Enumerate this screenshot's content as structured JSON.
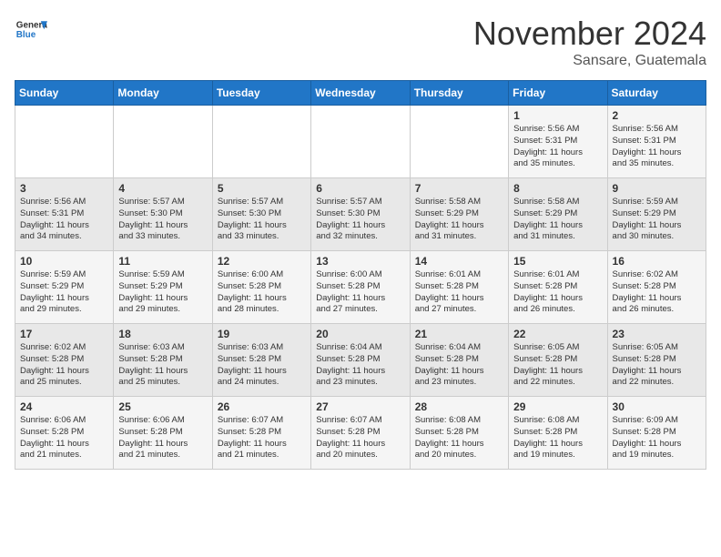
{
  "header": {
    "logo": {
      "general": "General",
      "blue": "Blue"
    },
    "title": "November 2024",
    "location": "Sansare, Guatemala"
  },
  "calendar": {
    "weekdays": [
      "Sunday",
      "Monday",
      "Tuesday",
      "Wednesday",
      "Thursday",
      "Friday",
      "Saturday"
    ],
    "weeks": [
      [
        {
          "day": "",
          "info": ""
        },
        {
          "day": "",
          "info": ""
        },
        {
          "day": "",
          "info": ""
        },
        {
          "day": "",
          "info": ""
        },
        {
          "day": "",
          "info": ""
        },
        {
          "day": "1",
          "info": "Sunrise: 5:56 AM\nSunset: 5:31 PM\nDaylight: 11 hours\nand 35 minutes."
        },
        {
          "day": "2",
          "info": "Sunrise: 5:56 AM\nSunset: 5:31 PM\nDaylight: 11 hours\nand 35 minutes."
        }
      ],
      [
        {
          "day": "3",
          "info": "Sunrise: 5:56 AM\nSunset: 5:31 PM\nDaylight: 11 hours\nand 34 minutes."
        },
        {
          "day": "4",
          "info": "Sunrise: 5:57 AM\nSunset: 5:30 PM\nDaylight: 11 hours\nand 33 minutes."
        },
        {
          "day": "5",
          "info": "Sunrise: 5:57 AM\nSunset: 5:30 PM\nDaylight: 11 hours\nand 33 minutes."
        },
        {
          "day": "6",
          "info": "Sunrise: 5:57 AM\nSunset: 5:30 PM\nDaylight: 11 hours\nand 32 minutes."
        },
        {
          "day": "7",
          "info": "Sunrise: 5:58 AM\nSunset: 5:29 PM\nDaylight: 11 hours\nand 31 minutes."
        },
        {
          "day": "8",
          "info": "Sunrise: 5:58 AM\nSunset: 5:29 PM\nDaylight: 11 hours\nand 31 minutes."
        },
        {
          "day": "9",
          "info": "Sunrise: 5:59 AM\nSunset: 5:29 PM\nDaylight: 11 hours\nand 30 minutes."
        }
      ],
      [
        {
          "day": "10",
          "info": "Sunrise: 5:59 AM\nSunset: 5:29 PM\nDaylight: 11 hours\nand 29 minutes."
        },
        {
          "day": "11",
          "info": "Sunrise: 5:59 AM\nSunset: 5:29 PM\nDaylight: 11 hours\nand 29 minutes."
        },
        {
          "day": "12",
          "info": "Sunrise: 6:00 AM\nSunset: 5:28 PM\nDaylight: 11 hours\nand 28 minutes."
        },
        {
          "day": "13",
          "info": "Sunrise: 6:00 AM\nSunset: 5:28 PM\nDaylight: 11 hours\nand 27 minutes."
        },
        {
          "day": "14",
          "info": "Sunrise: 6:01 AM\nSunset: 5:28 PM\nDaylight: 11 hours\nand 27 minutes."
        },
        {
          "day": "15",
          "info": "Sunrise: 6:01 AM\nSunset: 5:28 PM\nDaylight: 11 hours\nand 26 minutes."
        },
        {
          "day": "16",
          "info": "Sunrise: 6:02 AM\nSunset: 5:28 PM\nDaylight: 11 hours\nand 26 minutes."
        }
      ],
      [
        {
          "day": "17",
          "info": "Sunrise: 6:02 AM\nSunset: 5:28 PM\nDaylight: 11 hours\nand 25 minutes."
        },
        {
          "day": "18",
          "info": "Sunrise: 6:03 AM\nSunset: 5:28 PM\nDaylight: 11 hours\nand 25 minutes."
        },
        {
          "day": "19",
          "info": "Sunrise: 6:03 AM\nSunset: 5:28 PM\nDaylight: 11 hours\nand 24 minutes."
        },
        {
          "day": "20",
          "info": "Sunrise: 6:04 AM\nSunset: 5:28 PM\nDaylight: 11 hours\nand 23 minutes."
        },
        {
          "day": "21",
          "info": "Sunrise: 6:04 AM\nSunset: 5:28 PM\nDaylight: 11 hours\nand 23 minutes."
        },
        {
          "day": "22",
          "info": "Sunrise: 6:05 AM\nSunset: 5:28 PM\nDaylight: 11 hours\nand 22 minutes."
        },
        {
          "day": "23",
          "info": "Sunrise: 6:05 AM\nSunset: 5:28 PM\nDaylight: 11 hours\nand 22 minutes."
        }
      ],
      [
        {
          "day": "24",
          "info": "Sunrise: 6:06 AM\nSunset: 5:28 PM\nDaylight: 11 hours\nand 21 minutes."
        },
        {
          "day": "25",
          "info": "Sunrise: 6:06 AM\nSunset: 5:28 PM\nDaylight: 11 hours\nand 21 minutes."
        },
        {
          "day": "26",
          "info": "Sunrise: 6:07 AM\nSunset: 5:28 PM\nDaylight: 11 hours\nand 21 minutes."
        },
        {
          "day": "27",
          "info": "Sunrise: 6:07 AM\nSunset: 5:28 PM\nDaylight: 11 hours\nand 20 minutes."
        },
        {
          "day": "28",
          "info": "Sunrise: 6:08 AM\nSunset: 5:28 PM\nDaylight: 11 hours\nand 20 minutes."
        },
        {
          "day": "29",
          "info": "Sunrise: 6:08 AM\nSunset: 5:28 PM\nDaylight: 11 hours\nand 19 minutes."
        },
        {
          "day": "30",
          "info": "Sunrise: 6:09 AM\nSunset: 5:28 PM\nDaylight: 11 hours\nand 19 minutes."
        }
      ]
    ]
  }
}
